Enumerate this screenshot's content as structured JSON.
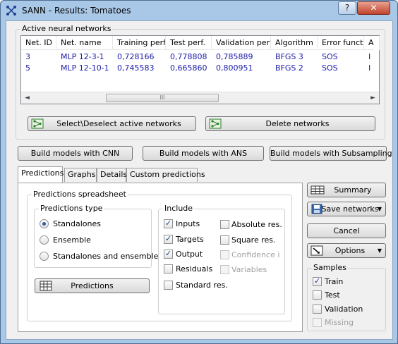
{
  "window": {
    "title": "SANN - Results: Tomatoes",
    "help_label": "?",
    "close_label": "✕"
  },
  "active_networks": {
    "group_title": "Active neural networks",
    "columns": [
      "Net. ID",
      "Net. name",
      "Training perf.",
      "Test perf.",
      "Validation perf.",
      "Algorithm",
      "Error funct.",
      "A"
    ],
    "rows": [
      [
        "3",
        "MLP 12-3-1",
        "0,728166",
        "0,778808",
        "0,785889",
        "BFGS 3",
        "SOS",
        "I"
      ],
      [
        "5",
        "MLP 12-10-1",
        "0,745583",
        "0,665860",
        "0,800951",
        "BFGS 2",
        "SOS",
        "I"
      ]
    ],
    "scroll_left": "◄",
    "scroll_right": "►",
    "scroll_grip": "III",
    "select_label": "Select\\Deselect active networks",
    "delete_label": "Delete networks"
  },
  "models": {
    "cnn": "Build models with CNN",
    "ans": "Build models with ANS",
    "subsampling": "Build models with Subsampling"
  },
  "tabs": [
    "Predictions",
    "Graphs",
    "Details",
    "Custom predictions"
  ],
  "predictions": {
    "group_title": "Predictions spreadsheet",
    "type_title": "Predictions type",
    "type_options": [
      "Standalones",
      "Ensemble",
      "Standalones and ensemble"
    ],
    "selected_type": "Standalones",
    "include_title": "Include",
    "include": {
      "inputs": "Inputs",
      "targets": "Targets",
      "output": "Output",
      "residuals": "Residuals",
      "standard_res": "Standard res.",
      "absolute_res": "Absolute res.",
      "square_res": "Square res.",
      "confidence": "Confidence i",
      "variables": "Variables"
    },
    "checked": [
      "Inputs",
      "Targets",
      "Output"
    ],
    "predictions_button": "Predictions"
  },
  "right": {
    "summary": "Summary",
    "save_networks": "Save networks",
    "cancel": "Cancel",
    "options": "Options",
    "dropdown_arrow": "▼",
    "samples_title": "Samples",
    "samples": {
      "train": "Train",
      "test": "Test",
      "validation": "Validation",
      "missing": "Missing"
    }
  }
}
